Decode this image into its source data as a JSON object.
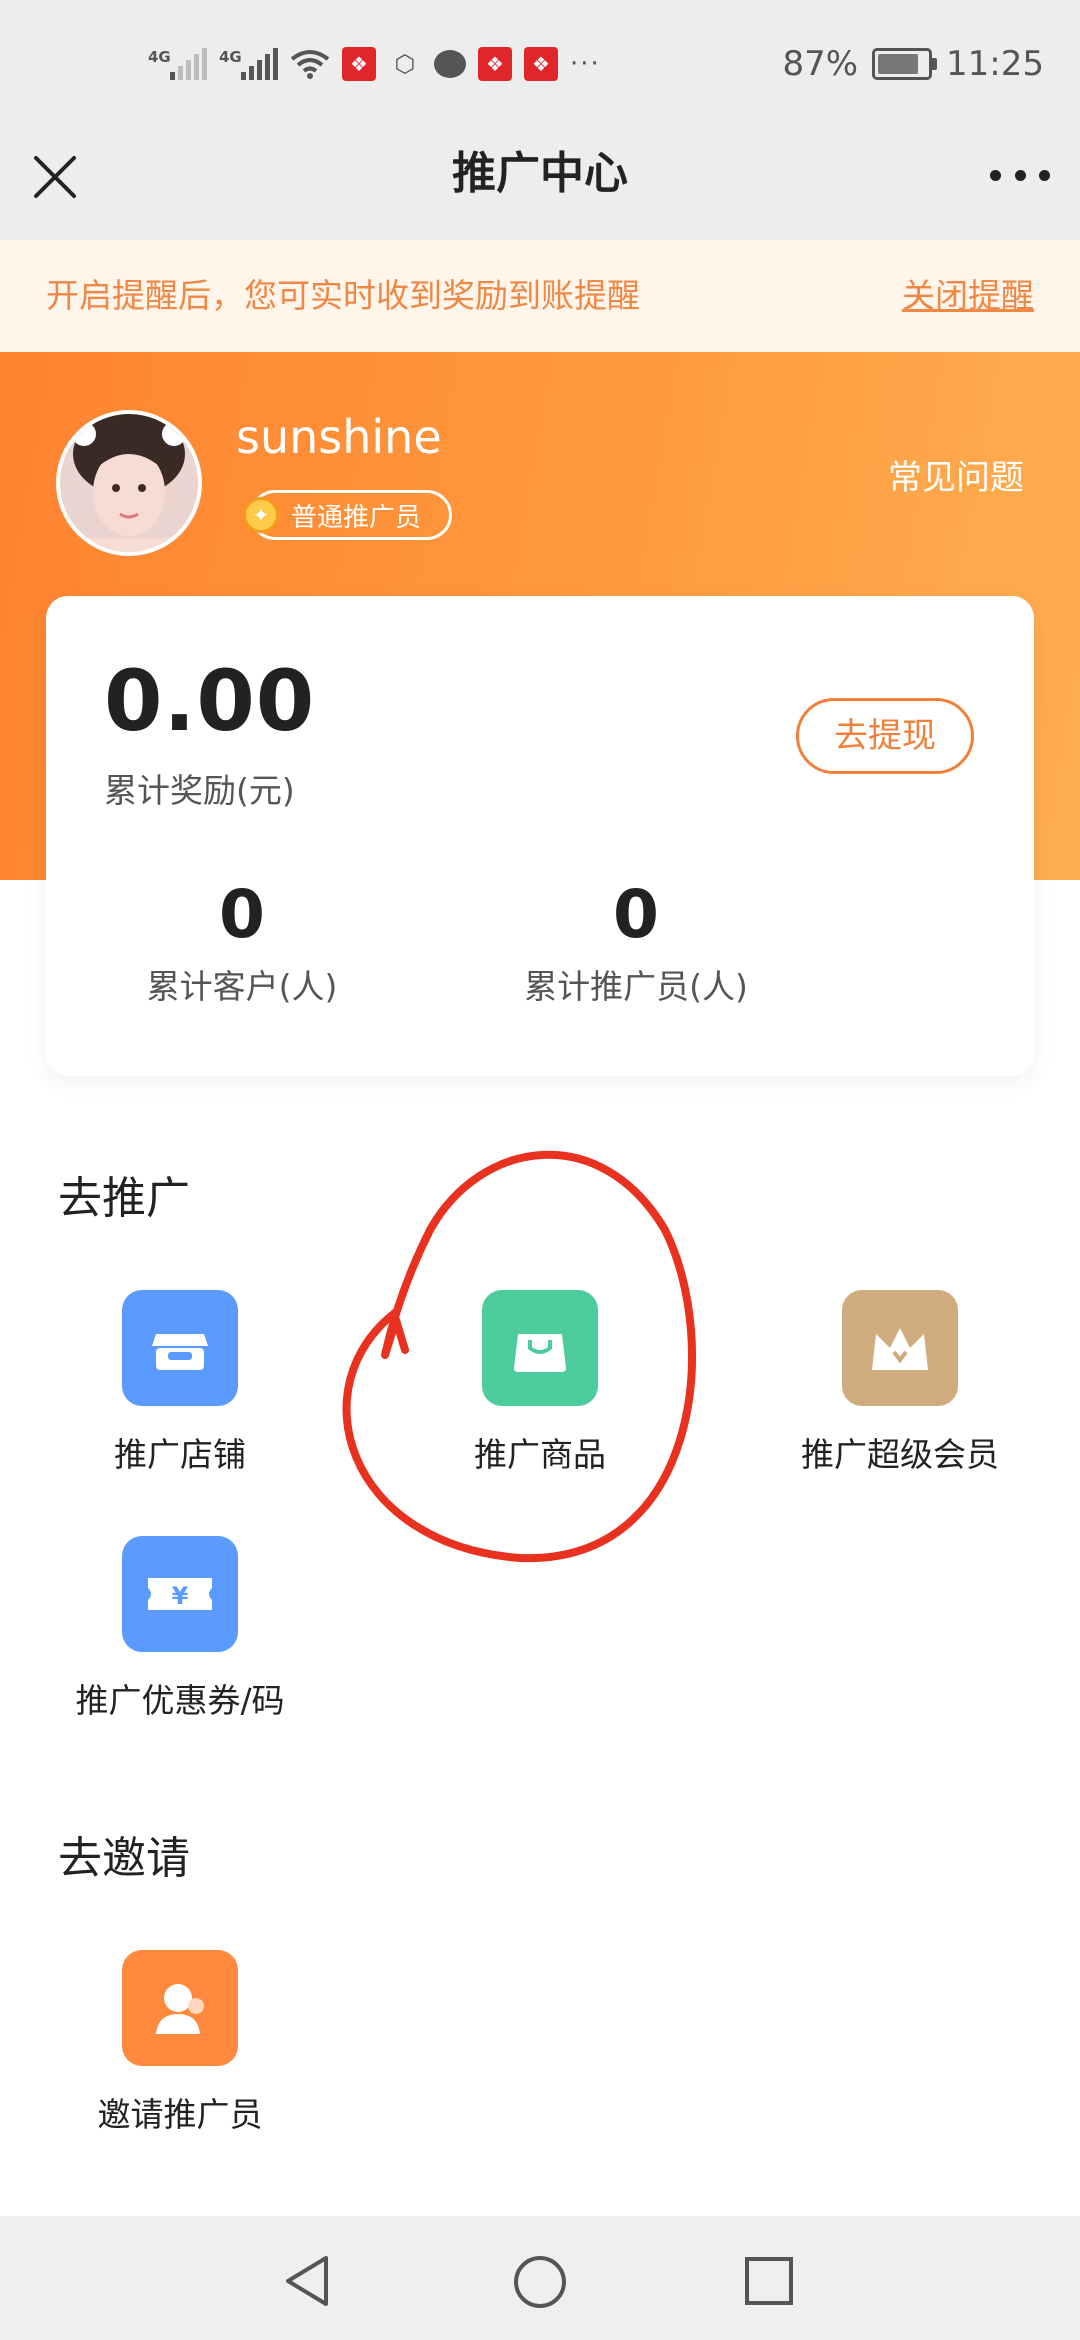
{
  "status_bar": {
    "network_1": "4G",
    "network_2": "4G",
    "battery": "87%",
    "time": "11:25",
    "icons": [
      "signal-icon",
      "signal-icon",
      "wifi-icon",
      "app-notification-icon",
      "hand-icon",
      "chat-icon",
      "app-notification-icon",
      "app-notification-icon",
      "more-notifications-icon",
      "battery-icon"
    ]
  },
  "nav": {
    "title": "推广中心",
    "close_icon": "close-icon",
    "more_icon": "more-icon"
  },
  "notice": {
    "text": "开启提醒后，您可实时收到奖励到账提醒",
    "close_label": "关闭提醒"
  },
  "profile": {
    "username": "sunshine",
    "level": "普通推广员",
    "faq": "常见问题"
  },
  "stats": {
    "reward_value": "0.00",
    "reward_label": "累计奖励(元)",
    "withdraw_label": "去提现",
    "customers_value": "0",
    "customers_label": "累计客户(人)",
    "promoters_value": "0",
    "promoters_label": "累计推广员(人)"
  },
  "promote": {
    "title": "去推广",
    "items": [
      {
        "label": "推广店铺",
        "icon": "store-icon",
        "color": "#5b9bff"
      },
      {
        "label": "推广商品",
        "icon": "shopping-bag-icon",
        "color": "#4ccb9c"
      },
      {
        "label": "推广超级会员",
        "icon": "crown-icon",
        "color": "#cfab7d"
      },
      {
        "label": "推广优惠券/码",
        "icon": "coupon-icon",
        "color": "#5b9bff"
      }
    ]
  },
  "invite": {
    "title": "去邀请",
    "items": [
      {
        "label": "邀请推广员",
        "icon": "invite-user-icon",
        "color": "#ff8a3d"
      }
    ]
  },
  "system_nav": {
    "back_icon": "back-icon",
    "home_icon": "home-icon",
    "recents_icon": "recents-icon"
  },
  "colors": {
    "accent": "#f0803a",
    "annotation": "#e8321f"
  }
}
